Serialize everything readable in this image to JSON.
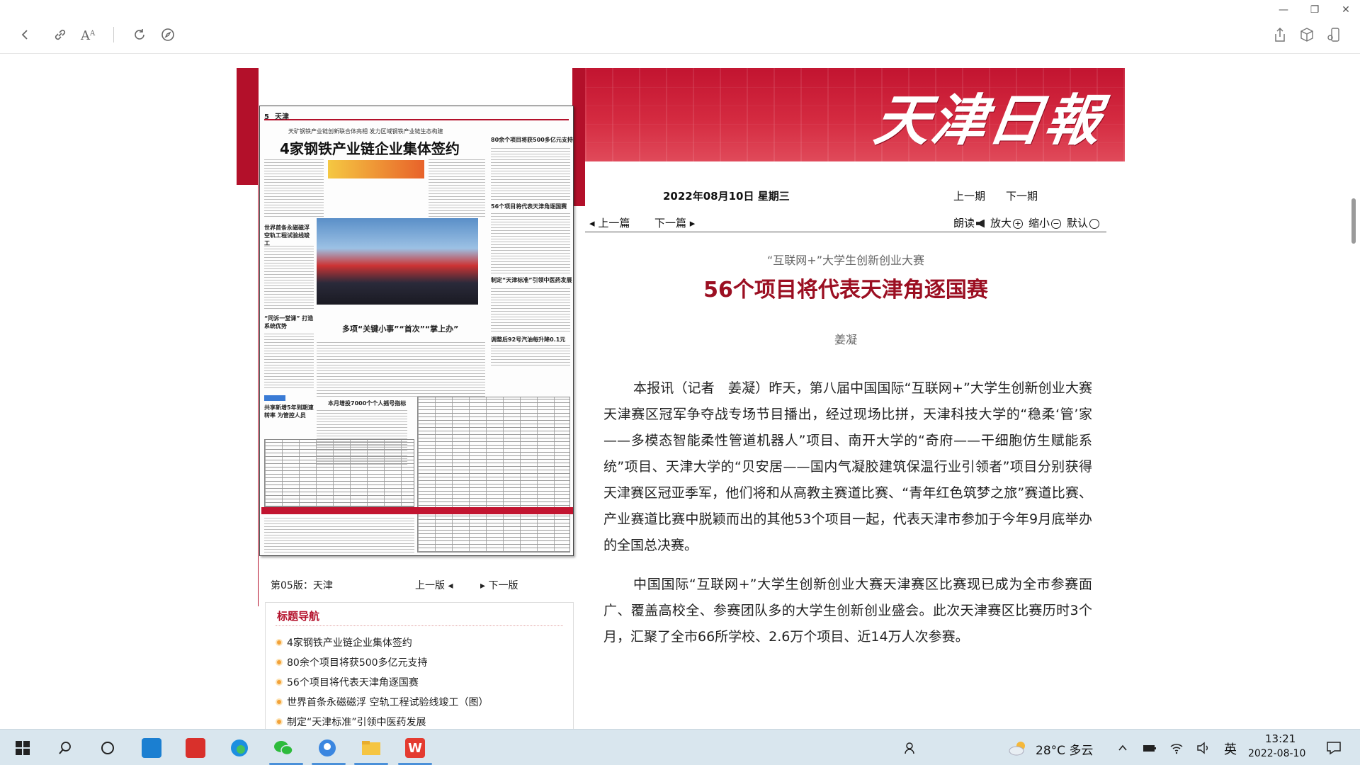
{
  "toolbar": {
    "icons": [
      "back-icon",
      "link-icon",
      "font-size-icon",
      "refresh-icon",
      "compass-icon"
    ],
    "right_icons": [
      "share-icon",
      "cube-icon",
      "phone-icon"
    ],
    "window_controls": [
      "minimize",
      "restore",
      "close"
    ]
  },
  "masthead": {
    "title": "天津日報"
  },
  "newspaper_thumb": {
    "page_no": "5",
    "section": "天津",
    "sub_headline": "天矿钢铁产业链创新联合体亮相 发力区域钢铁产业链生态构建",
    "headline": "4家钢铁产业链企业集体签约",
    "col_heads": [
      "80余个项目将获500多亿元支持",
      "56个项目将代表天津角逐国赛",
      "制定“天津标准”引领中医药发展",
      "世界首条永磁磁浮 空轨工程试验线竣工",
      "多项“关键小事”“首次”“掌上办”",
      "本月增投7000个个人摇号指标",
      "调整后92号汽油每升降0.1元",
      "“同诉一堂课” 打造系统优势",
      "共享新增5年到期速转率 为管控人员"
    ]
  },
  "page_nav": {
    "current": "第05版：天津",
    "prev": "上一版",
    "next": "下一版"
  },
  "title_nav": {
    "heading": "标题导航",
    "items": [
      "4家钢铁产业链企业集体签约",
      "80余个项目将获500多亿元支持",
      "56个项目将代表天津角逐国赛",
      "世界首条永磁磁浮 空轨工程试验线竣工（图）",
      "制定“天津标准”引领中医药发展"
    ]
  },
  "issue": {
    "date": "2022年08月10日  星期三",
    "prev_issue": "上一期",
    "next_issue": "下一期"
  },
  "article_nav": {
    "prev": "上一篇",
    "next": "下一篇",
    "read": "朗读",
    "zoom_in": "放大",
    "zoom_out": "缩小",
    "default": "默认"
  },
  "article": {
    "kicker": "“互联网+”大学生创新创业大赛",
    "headline": "56个项目将代表天津角逐国赛",
    "byline": "姜凝",
    "paragraphs": [
      "本报讯（记者　姜凝）昨天，第八届中国国际“互联网+”大学生创新创业大赛天津赛区冠军争夺战专场节目播出，经过现场比拼，天津科技大学的“稳柔‘管’家——多模态智能柔性管道机器人”项目、南开大学的“奇府——干细胞仿生赋能系统”项目、天津大学的“贝安居——国内气凝胶建筑保温行业引领者”项目分别获得天津赛区冠亚季军，他们将和从高教主赛道比赛、“青年红色筑梦之旅”赛道比赛、产业赛道比赛中脱颖而出的其他53个项目一起，代表天津市参加于今年9月底举办的全国总决赛。",
      "中国国际“互联网+”大学生创新创业大赛天津赛区比赛现已成为全市参赛面广、覆盖高校全、参赛团队多的大学生创新创业盛会。此次天津赛区比赛历时3个月，汇聚了全市66所学校、2.6万个项目、近14万人次参赛。"
    ]
  },
  "taskbar": {
    "apps": [
      "start-icon",
      "search-icon",
      "cortana-icon",
      "store-app-icon",
      "youdao-app-icon",
      "edge-icon",
      "wechat-icon",
      "browser-icon",
      "explorer-icon",
      "wps-icon"
    ],
    "weather": "28°C  多云",
    "ime": "英",
    "time": "13:21",
    "date": "2022-08-10"
  }
}
